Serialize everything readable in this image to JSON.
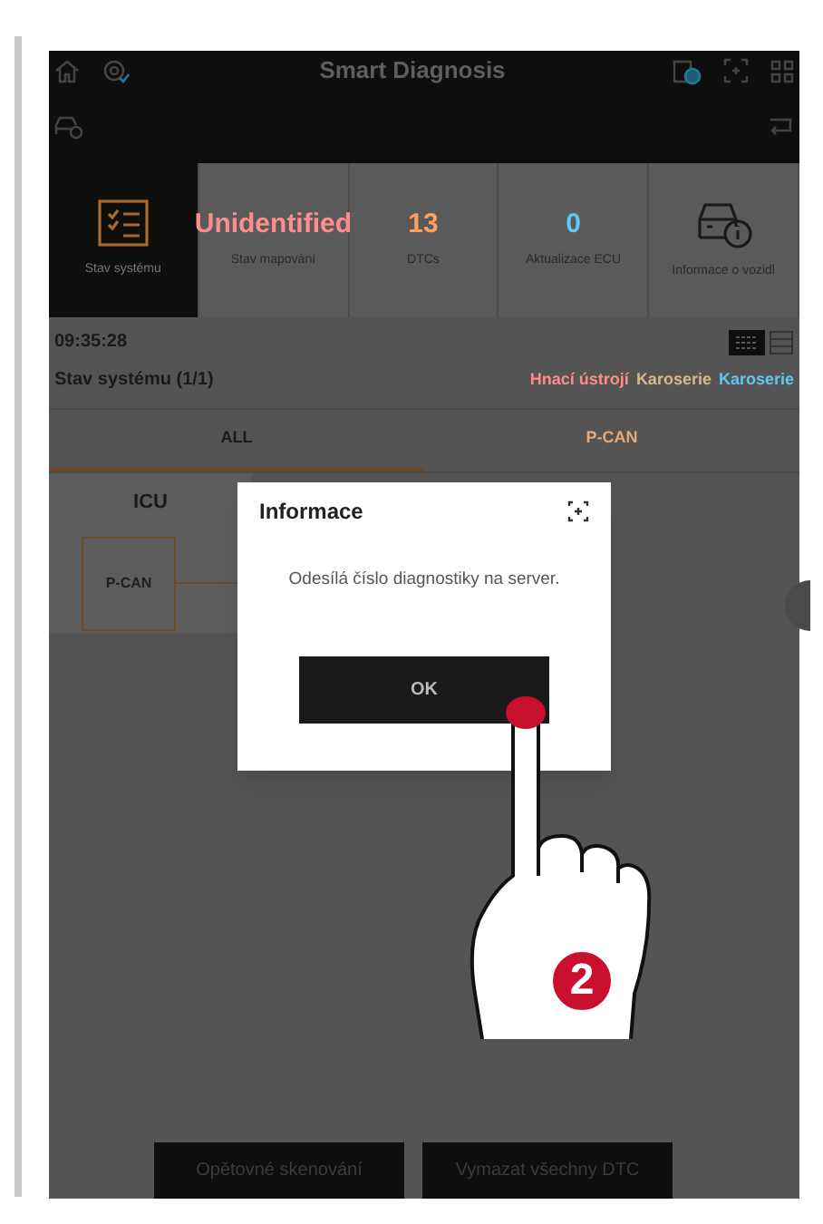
{
  "header": {
    "title": "Smart Diagnosis"
  },
  "tiles": [
    {
      "kind": "checklist",
      "label": "Stav systému",
      "selected": true
    },
    {
      "kind": "value",
      "value": "Unidentified",
      "color": "#ff8c8c",
      "label": "Stav mapování",
      "selected": false
    },
    {
      "kind": "value",
      "value": "13",
      "color": "#ffa060",
      "label": "DTCs",
      "selected": false
    },
    {
      "kind": "value",
      "value": "0",
      "color": "#60c8f0",
      "label": "Aktualizace ECU",
      "selected": false
    },
    {
      "kind": "car-info",
      "label": "Informace o vozidl",
      "selected": false
    }
  ],
  "status": {
    "time": "09:35:28",
    "title": "Stav systému (1/1)",
    "legend": [
      {
        "label": "Hnací ústrojí",
        "color": "#ff8c8c"
      },
      {
        "label": "Karoserie",
        "color": "#d8b888"
      },
      {
        "label": "Karoserie",
        "color": "#60c8f0"
      }
    ]
  },
  "tabs": [
    {
      "label": "ALL",
      "selected": true
    },
    {
      "label": "P-CAN",
      "selected": false
    }
  ],
  "network": {
    "node": "ICU",
    "bus": "P-CAN"
  },
  "dialog": {
    "title": "Informace",
    "message": "Odesílá číslo diagnostiky na server.",
    "button": "OK"
  },
  "step_badge": "2",
  "footer_buttons": [
    "Opětovné skenování",
    "Vymazat všechny DTC"
  ]
}
